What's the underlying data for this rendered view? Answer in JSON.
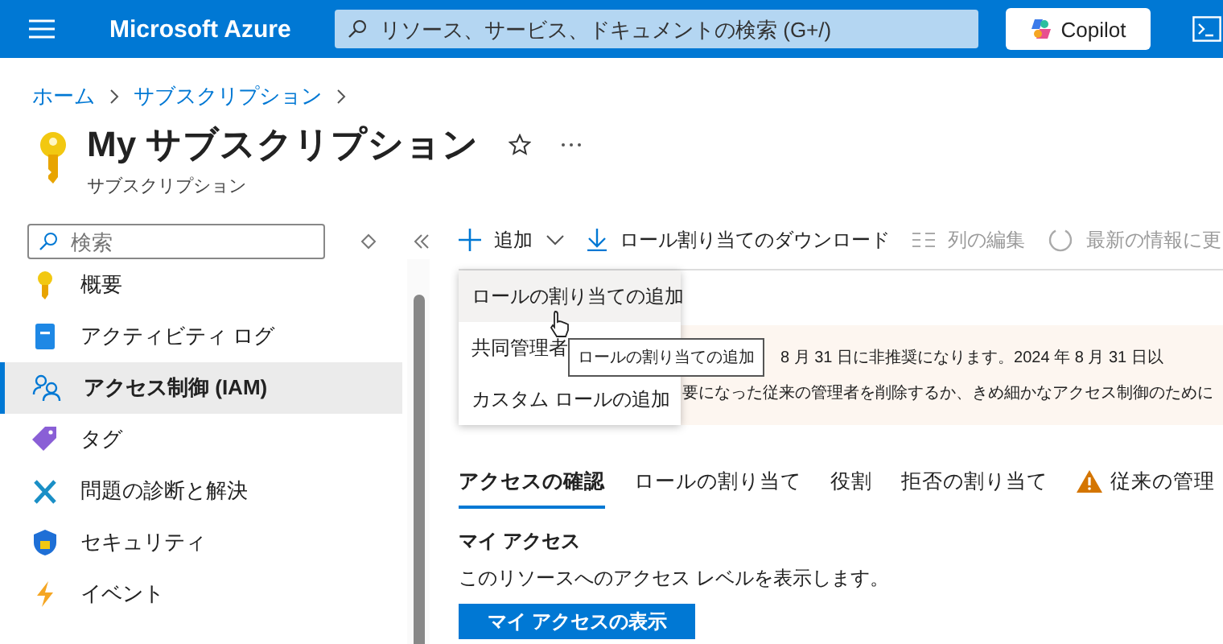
{
  "header": {
    "brand": "Microsoft Azure",
    "search": {
      "placeholder": "リソース、サービス、ドキュメントの検索 (G+/)"
    },
    "copilot": "Copilot"
  },
  "breadcrumb": [
    "ホーム",
    "サブスクリプション"
  ],
  "page": {
    "title": "My サブスクリプション",
    "subtitle": "サブスクリプション"
  },
  "sidebar": {
    "search": {
      "placeholder": "検索"
    },
    "items": [
      {
        "label": "概要",
        "selected": false
      },
      {
        "label": "アクティビティ ログ",
        "selected": false
      },
      {
        "label": "アクセス制御 (IAM)",
        "selected": true
      },
      {
        "label": "タグ",
        "selected": false
      },
      {
        "label": "問題の診断と解決",
        "selected": false
      },
      {
        "label": "セキュリティ",
        "selected": false
      },
      {
        "label": "イベント",
        "selected": false
      }
    ]
  },
  "toolbar": [
    {
      "label": "追加",
      "dropdown": true,
      "disabled": false
    },
    {
      "label": "ロール割り当てのダウンロード",
      "dropdown": false,
      "disabled": false
    },
    {
      "label": "列の編集",
      "dropdown": false,
      "disabled": true
    },
    {
      "label": "最新の情報に更",
      "dropdown": false,
      "disabled": true
    }
  ],
  "add_menu": {
    "items": [
      {
        "label": "ロールの割り当ての追加",
        "selected": true
      },
      {
        "label": "共同管理者",
        "selected": false
      },
      {
        "label": "カスタム ロールの追加",
        "selected": false
      }
    ],
    "tooltip": "ロールの割り当ての追加"
  },
  "banner": {
    "lines": [
      "8 月 31 日に非推奨になります。2024 年 8 月 31 日以",
      "要になった従来の管理者を削除するか、きめ細かなアクセス制御のために"
    ]
  },
  "tabs": [
    {
      "label": "アクセスの確認",
      "selected": true,
      "warning": false
    },
    {
      "label": "ロールの割り当て",
      "selected": false,
      "warning": false
    },
    {
      "label": "役割",
      "selected": false,
      "warning": false
    },
    {
      "label": "拒否の割り当て",
      "selected": false,
      "warning": false
    },
    {
      "label": "従来の管理",
      "selected": false,
      "warning": true
    }
  ],
  "my_access": {
    "heading": "マイ アクセス",
    "description": "このリソースへのアクセス レベルを表示します。",
    "button": "マイ アクセスの表示"
  }
}
